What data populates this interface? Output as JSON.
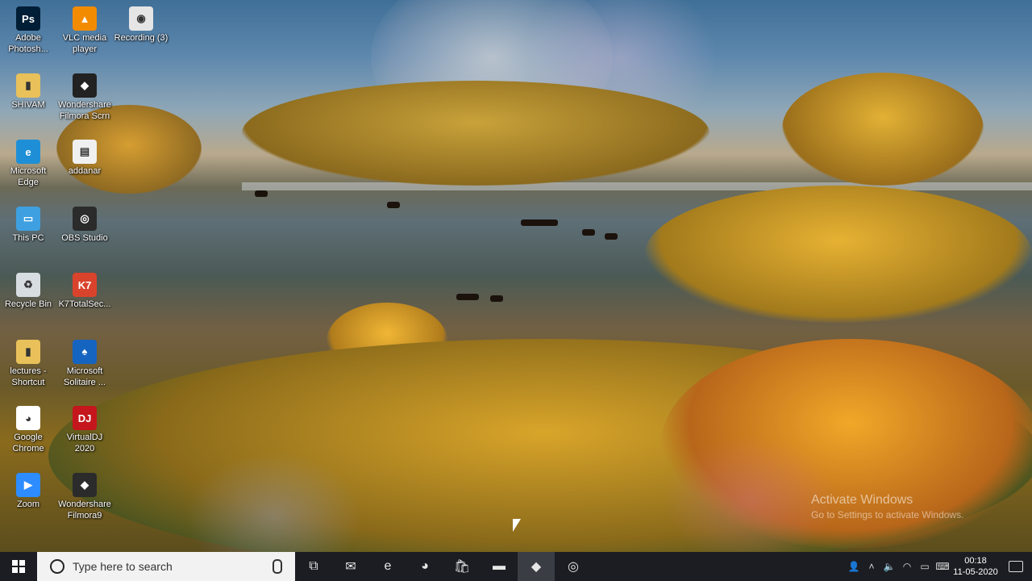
{
  "desktop_icons": [
    {
      "label": "Adobe Photosh...",
      "icon": "photoshop-icon",
      "color": "#001e36",
      "glyph": "Ps"
    },
    {
      "label": "VLC media player",
      "icon": "vlc-icon",
      "color": "#f28b00",
      "glyph": "▲"
    },
    {
      "label": "Recording (3)",
      "icon": "recording-icon",
      "color": "#e5e5e5",
      "glyph": "◉"
    },
    {
      "label": "SHIVAM",
      "icon": "folder-user-icon",
      "color": "#e8c15a",
      "glyph": "▮"
    },
    {
      "label": "Wondershare Filmora Scrn",
      "icon": "filmora-scrn-icon",
      "color": "#222222",
      "glyph": "◆"
    },
    {
      "label": "Microsoft Edge",
      "icon": "edge-icon",
      "color": "#1e8fd6",
      "glyph": "e"
    },
    {
      "label": "addanar",
      "icon": "file-icon",
      "color": "#f0f0f0",
      "glyph": "▤"
    },
    {
      "label": "This PC",
      "icon": "this-pc-icon",
      "color": "#3ea0e0",
      "glyph": "▭"
    },
    {
      "label": "OBS Studio",
      "icon": "obs-icon",
      "color": "#2b2b2b",
      "glyph": "◎"
    },
    {
      "label": "Recycle Bin",
      "icon": "recycle-bin-icon",
      "color": "#d8dde2",
      "glyph": "♻"
    },
    {
      "label": "K7TotalSec...",
      "icon": "k7-icon",
      "color": "#d9432c",
      "glyph": "K7"
    },
    {
      "label": "lectures - Shortcut",
      "icon": "folder-shortcut-icon",
      "color": "#e8c15a",
      "glyph": "▮"
    },
    {
      "label": "Microsoft Solitaire ...",
      "icon": "solitaire-icon",
      "color": "#1564c0",
      "glyph": "♠"
    },
    {
      "label": "Google Chrome",
      "icon": "chrome-icon",
      "color": "#ffffff",
      "glyph": "◕"
    },
    {
      "label": "VirtualDJ 2020",
      "icon": "virtualdj-icon",
      "color": "#c4161c",
      "glyph": "DJ"
    },
    {
      "label": "Zoom",
      "icon": "zoom-icon",
      "color": "#2d8cff",
      "glyph": "▶"
    },
    {
      "label": "Wondershare Filmora9",
      "icon": "filmora9-icon",
      "color": "#2b2b2b",
      "glyph": "◆"
    }
  ],
  "watermark": {
    "title": "Activate Windows",
    "subtitle": "Go to Settings to activate Windows."
  },
  "taskbar": {
    "start_label": "Start",
    "search_placeholder": "Type here to search",
    "apps": [
      {
        "name": "task-view-icon",
        "glyph": "⧉"
      },
      {
        "name": "mail-icon",
        "glyph": "✉"
      },
      {
        "name": "edge-taskbar-icon",
        "glyph": "e"
      },
      {
        "name": "chrome-taskbar-icon",
        "glyph": "◕"
      },
      {
        "name": "store-icon",
        "glyph": "🛍"
      },
      {
        "name": "file-explorer-icon",
        "glyph": "▬"
      },
      {
        "name": "filmora-taskbar-icon",
        "glyph": "◆"
      },
      {
        "name": "obs-taskbar-icon",
        "glyph": "◎"
      }
    ]
  },
  "tray": {
    "time": "00:18",
    "date": "11-05-2020"
  }
}
